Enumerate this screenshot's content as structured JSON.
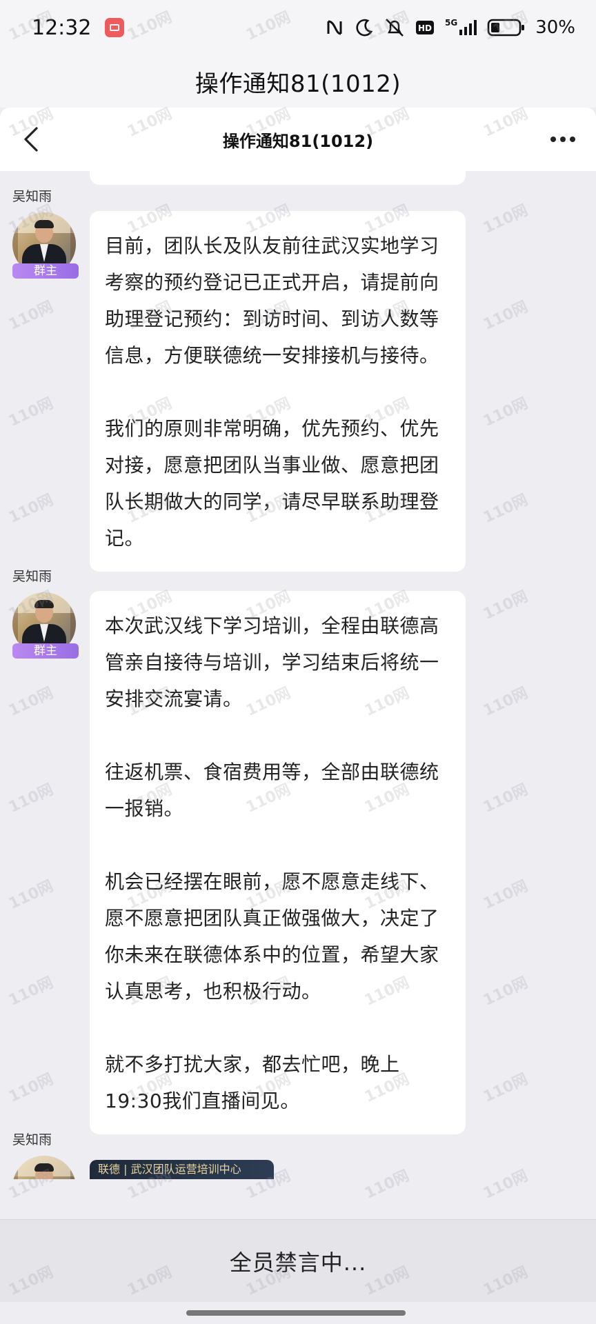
{
  "status_bar": {
    "time": "12:32",
    "network": "5G",
    "hd": "HD",
    "battery": "30%"
  },
  "app": {
    "title": "操作通知81(1012)"
  },
  "nav": {
    "title": "操作通知81(1012)"
  },
  "messages": [
    {
      "sender": "吴知雨",
      "role": "群主",
      "paragraphs": [
        "目前，团队长及队友前往武汉实地学习考察的预约登记已正式开启，请提前向助理登记预约：到访时间、到访人数等信息，方便联德统一安排接机与接待。",
        "我们的原则非常明确，优先预约、优先对接，愿意把团队当事业做、愿意把团队长期做大的同学，请尽早联系助理登记。"
      ]
    },
    {
      "sender": "吴知雨",
      "role": "群主",
      "paragraphs": [
        "本次武汉线下学习培训，全程由联德高管亲自接待与培训，学习结束后将统一安排交流宴请。",
        "往返机票、食宿费用等，全部由联德统一报销。",
        "机会已经摆在眼前，愿不愿意走线下、愿不愿意把团队真正做强做大，决定了你未来在联德体系中的位置，希望大家认真思考，也积极行动。",
        "就不多打扰大家，都去忙吧，晚上19:30我们直播间见。"
      ]
    },
    {
      "sender": "吴知雨",
      "role": "",
      "image_caption": "联德 | 武汉团队运营培训中心"
    }
  ],
  "bottom_bar": {
    "muted_text": "全员禁言中..."
  },
  "watermark": "110网",
  "colors": {
    "badge": "#9a6ce6",
    "background": "#ededf2",
    "bubble": "#ffffff"
  }
}
